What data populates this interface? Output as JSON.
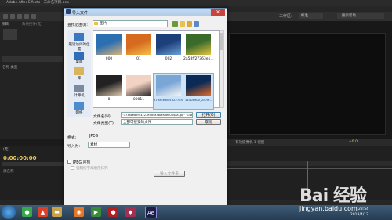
{
  "app": {
    "title": "Adobe After Effects - 未命名项目.aep",
    "workspace_label": "工作区:",
    "workspace_value": "标准",
    "search_help": "搜索帮助"
  },
  "project_panel": {
    "tab": "项目",
    "effects_tab": "效果控件(无)",
    "columns": "名称  类型"
  },
  "composition": {
    "bottom_bar": "有效摄像机   1 视图",
    "counter": "+0.0"
  },
  "timeline": {
    "tab": "(无)",
    "timecode": "0;00;00;00",
    "columns": "源名称"
  },
  "dialog": {
    "title": "导入文件",
    "lookin_label": "查找范围(I):",
    "lookin_value": "图片",
    "places": [
      {
        "label": "最近访问的位置",
        "icon": "recent-places-icon"
      },
      {
        "label": "桌面",
        "icon": "desktop-icon"
      },
      {
        "label": "库",
        "icon": "libraries-icon"
      },
      {
        "label": "计算机",
        "icon": "computer-icon"
      },
      {
        "label": "网络",
        "icon": "network-icon"
      }
    ],
    "files": [
      {
        "name": "000",
        "colors": [
          "#2b6fb0",
          "#d9b27a"
        ]
      },
      {
        "name": "01",
        "colors": [
          "#d66a1e",
          "#f5c04a"
        ]
      },
      {
        "name": "002",
        "colors": [
          "#1d3f7a",
          "#6aa0d8"
        ]
      },
      {
        "name": "2a58ff27363e1...",
        "colors": [
          "#3b6b2a",
          "#e2c23e"
        ]
      },
      {
        "name": "8",
        "colors": [
          "#222",
          "#d8c4a8"
        ]
      },
      {
        "name": "00011",
        "colors": [
          "#f2d2c2",
          "#2d2a2a"
        ]
      },
      {
        "name": "373acedbf53227e5d4a7bafa...",
        "colors": [
          "#7aa6d6",
          "#f4f4f4"
        ]
      },
      {
        "name": "1440x900_2d7e...",
        "colors": [
          "#0b2a55",
          "#e06a2a"
        ]
      }
    ],
    "filename_label": "文件名(N):",
    "filename_value": "\"373acedbf53227e5d4a7bafa3ee0b4aa.jpg\" \"1440x900_2d7eac6f.jpg\"",
    "filetype_label": "文件类型(T):",
    "filetype_value": "全部可接受的文件",
    "open_button": "打开(O)",
    "cancel_button": "取消",
    "format_label": "格式:",
    "format_value": "JPEG",
    "import_as_label": "导入为:",
    "import_as_value": "素材",
    "jpeg_sequence_label": "JPEG 序列",
    "force_alpha_label": "强制按字母顺序排列",
    "import_folder_button": "导入文件夹"
  },
  "taskbar": {
    "time": "23:54",
    "date": "2018/4/12"
  },
  "watermark": {
    "logo_text": "Bai 经验",
    "url": "jingyan.baidu.com"
  }
}
